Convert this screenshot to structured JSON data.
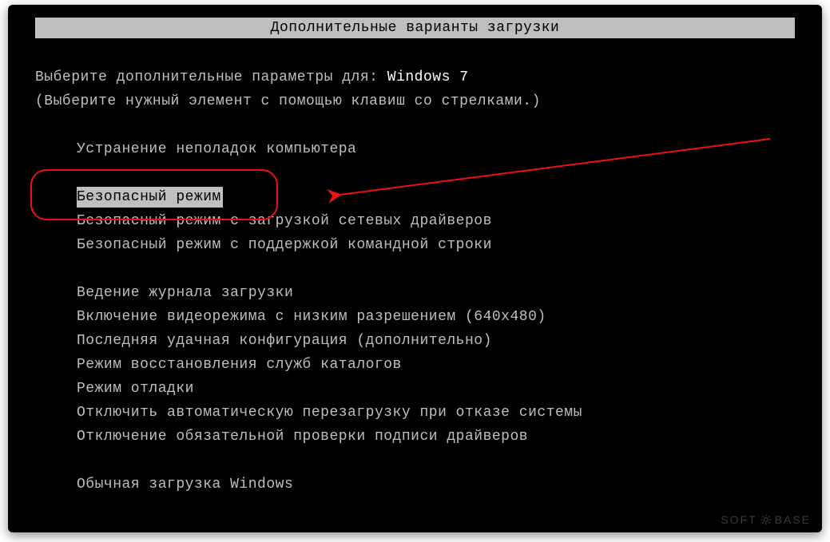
{
  "title": "Дополнительные варианты загрузки",
  "prompt_prefix": "Выберите дополнительные параметры для: ",
  "os_name": "Windows 7",
  "instruction": "(Выберите нужный элемент с помощью клавиш со стрелками.)",
  "option_repair": "Устранение неполадок компьютера",
  "options_safe": [
    "Безопасный режим",
    "Безопасный режим с загрузкой сетевых драйверов",
    "Безопасный режим с поддержкой командной строки"
  ],
  "options_other": [
    "Ведение журнала загрузки",
    "Включение видеорежима с низким разрешением (640x480)",
    "Последняя удачная конфигурация (дополнительно)",
    "Режим восстановления служб каталогов",
    "Режим отладки",
    "Отключить автоматическую перезагрузку при отказе системы",
    "Отключение обязательной проверки подписи драйверов"
  ],
  "option_normal": "Обычная загрузка Windows",
  "selected_index": 0,
  "watermark": {
    "left": "SOFT",
    "right": "BASE"
  },
  "colors": {
    "bg": "#000000",
    "fg": "#bfbfbf",
    "highlight_bg": "#bfbfbf",
    "highlight_fg": "#000000",
    "annotation": "#ee1111"
  }
}
